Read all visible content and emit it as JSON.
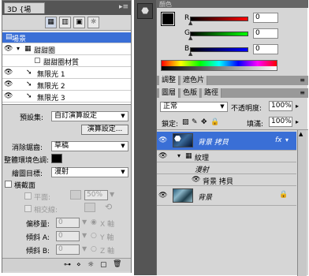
{
  "panel3d": {
    "tab": "3D {場景}",
    "tree": [
      {
        "label": "場景",
        "selected": true
      },
      {
        "label": "甜甜圈"
      },
      {
        "label": "甜甜圈材質"
      },
      {
        "label": "無限光 1"
      },
      {
        "label": "無限光 2"
      },
      {
        "label": "無限光 3"
      }
    ],
    "props": {
      "preset_label": "預設集:",
      "preset_value": "自訂演算設定",
      "render_settings_btn": "演算設定...",
      "antialias_label": "消除鋸齒:",
      "antialias_value": "草稿",
      "ambient_label": "整體環境色調:",
      "paint_on_label": "繪圖目標:",
      "paint_on_value": "漫射",
      "cross_section_label": "橫截面",
      "plane_label": "平面:",
      "plane_pct": "50%",
      "intersect_label": "相交線:",
      "offset_label": "偏移量:",
      "tilt_a_label": "傾斜 A:",
      "tilt_b_label": "傾斜 B:",
      "zero": "0",
      "x_axis": "X 軸",
      "y_axis": "Y 軸",
      "z_axis": "Z 軸"
    }
  },
  "color": {
    "tab": "顏色",
    "r_label": "R",
    "g_label": "G",
    "b_label": "B",
    "r": "0",
    "g": "0",
    "b": "0"
  },
  "adjust_tabs": [
    "調整",
    "遮色片"
  ],
  "layers": {
    "tabs": [
      "圖層",
      "色版",
      "路徑"
    ],
    "blend_mode": "正常",
    "opacity_label": "不透明度:",
    "opacity": "100%",
    "lock_label": "鎖定:",
    "fill_label": "填滿:",
    "fill": "100%",
    "items": [
      {
        "name": "背景 拷貝",
        "fx": "fx",
        "selected": true
      },
      {
        "name": "紋理",
        "kind": "texture-group"
      },
      {
        "name": "漫射",
        "kind": "sub"
      },
      {
        "name": "背景 拷貝",
        "kind": "subsub"
      },
      {
        "name": "背景",
        "locked": true
      }
    ]
  },
  "colors": {
    "selection": "#3a6fd6"
  }
}
